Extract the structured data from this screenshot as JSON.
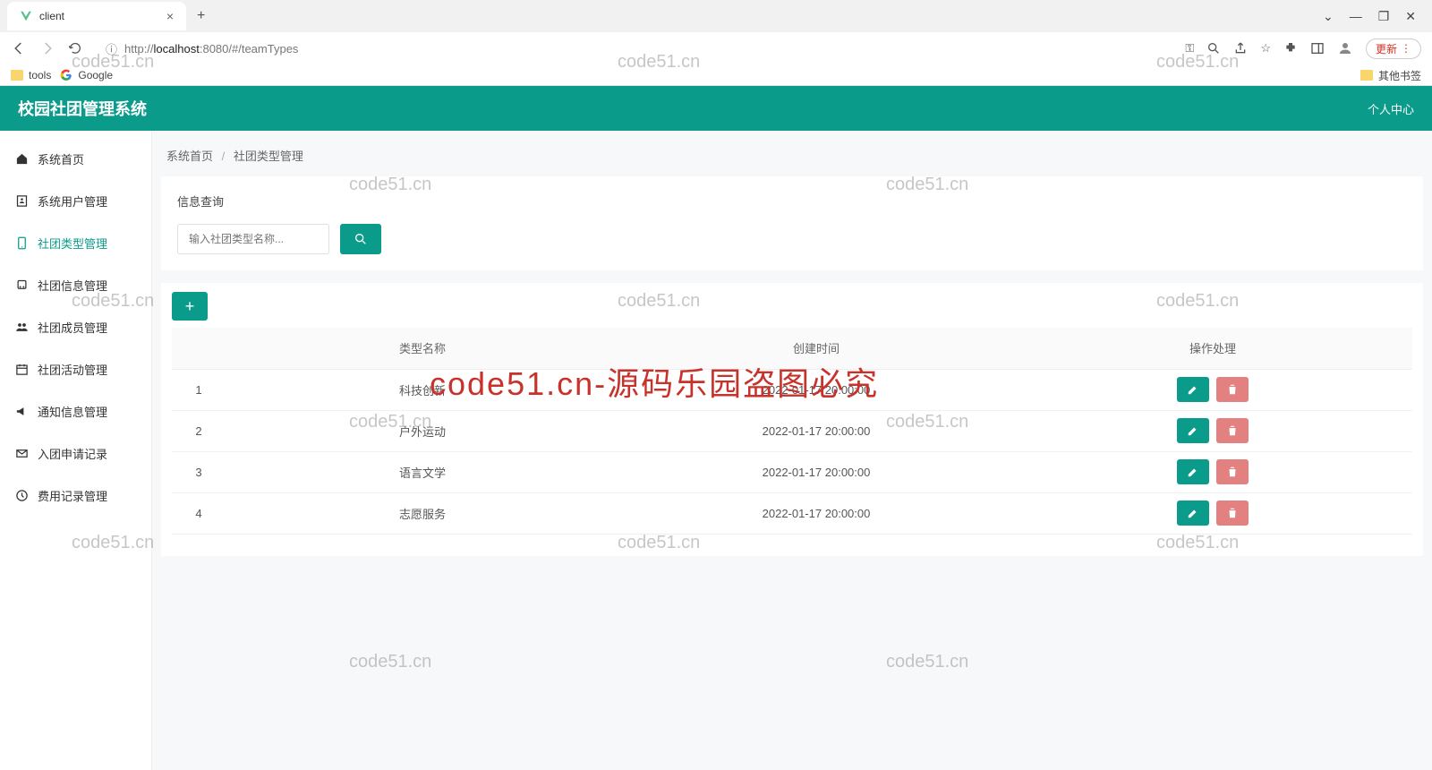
{
  "browser": {
    "tab_title": "client",
    "url_prefix": "http://",
    "url_host": "localhost",
    "url_rest": ":8080/#/teamTypes",
    "update_label": "更新",
    "bookmarks": {
      "tools": "tools",
      "google": "Google",
      "other": "其他书签"
    }
  },
  "header": {
    "title": "校园社团管理系统",
    "user_center": "个人中心"
  },
  "sidebar": {
    "items": [
      {
        "label": "系统首页"
      },
      {
        "label": "系统用户管理"
      },
      {
        "label": "社团类型管理"
      },
      {
        "label": "社团信息管理"
      },
      {
        "label": "社团成员管理"
      },
      {
        "label": "社团活动管理"
      },
      {
        "label": "通知信息管理"
      },
      {
        "label": "入团申请记录"
      },
      {
        "label": "费用记录管理"
      }
    ]
  },
  "breadcrumb": {
    "home": "系统首页",
    "current": "社团类型管理"
  },
  "search": {
    "panel_title": "信息查询",
    "placeholder": "输入社团类型名称..."
  },
  "table": {
    "headers": {
      "name": "类型名称",
      "time": "创建时间",
      "action": "操作处理"
    },
    "rows": [
      {
        "idx": "1",
        "name": "科技创新",
        "time": "2022-01-17 20:00:00"
      },
      {
        "idx": "2",
        "name": "户外运动",
        "time": "2022-01-17 20:00:00"
      },
      {
        "idx": "3",
        "name": "语言文学",
        "time": "2022-01-17 20:00:00"
      },
      {
        "idx": "4",
        "name": "志愿服务",
        "time": "2022-01-17 20:00:00"
      }
    ]
  },
  "watermarks": {
    "text": "code51.cn",
    "red": "code51.cn-源码乐园盗图必究"
  }
}
